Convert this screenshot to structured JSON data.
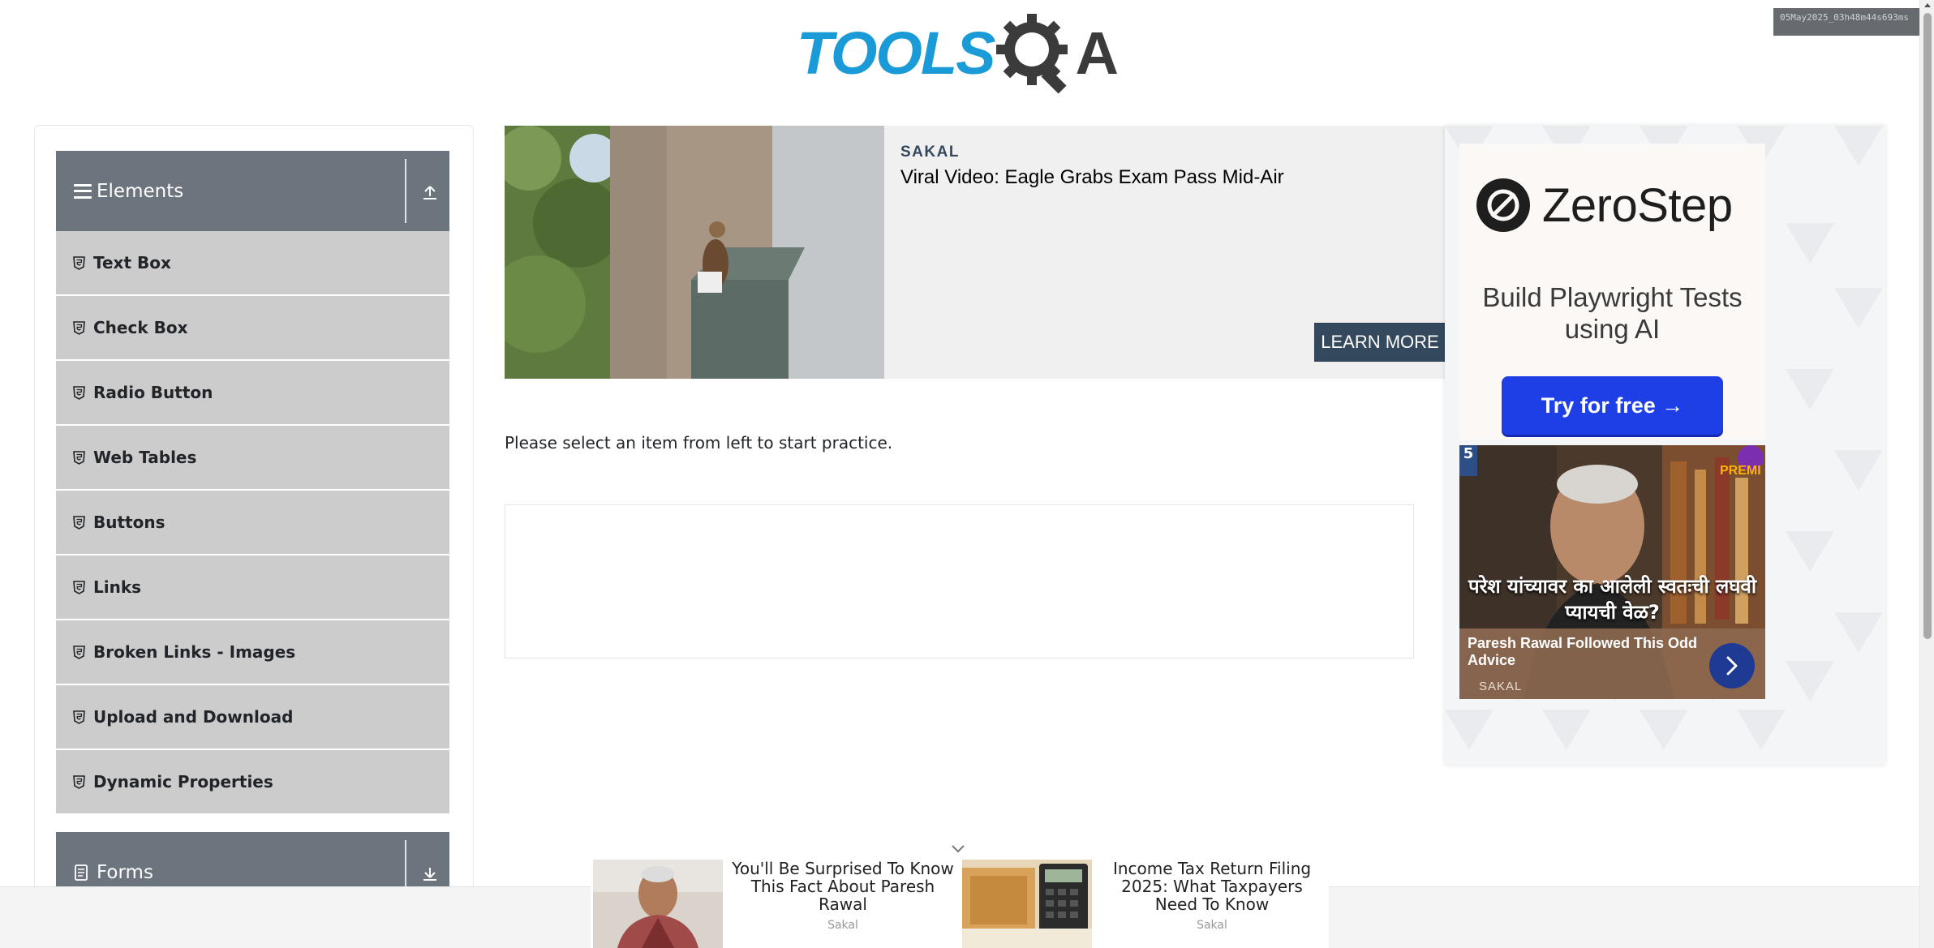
{
  "header": {
    "logo_part1": "TOOLS",
    "logo_part2": "A",
    "watermark": "05May2025_03h48m44s693ms"
  },
  "sidebar": {
    "groups": [
      {
        "title": "Elements",
        "expanded": true,
        "icon": "hamburger-icon",
        "items": [
          {
            "label": "Text Box"
          },
          {
            "label": "Check Box"
          },
          {
            "label": "Radio Button"
          },
          {
            "label": "Web Tables"
          },
          {
            "label": "Buttons"
          },
          {
            "label": "Links"
          },
          {
            "label": "Broken Links - Images"
          },
          {
            "label": "Upload and Download"
          },
          {
            "label": "Dynamic Properties"
          }
        ]
      },
      {
        "title": "Forms",
        "expanded": false,
        "icon": "document-icon"
      }
    ]
  },
  "main": {
    "ad": {
      "source": "SAKAL",
      "headline": "Viral Video: Eagle Grabs Exam Pass Mid-Air",
      "cta": "LEARN MORE"
    },
    "prompt": "Please select an item from left to start practice."
  },
  "right_ad": {
    "brand": "ZeroStep",
    "tagline": "Build Playwright Tests using AI",
    "cta": "Try for free →",
    "news": {
      "overlay_text": "परेश यांच्यावर का आलेली स्वतःची लघवी प्यायची वेळ?",
      "title": "Paresh Rawal Followed This Odd Advice",
      "source": "SAKAL",
      "badge": "PREMI",
      "corner": "5"
    }
  },
  "bottom_ad": {
    "items": [
      {
        "title": "You'll Be Surprised To Know This Fact About Paresh Rawal",
        "source": "Sakal"
      },
      {
        "title": "Income Tax Return Filing 2025: What Taxpayers Need To Know",
        "source": "Sakal"
      }
    ]
  },
  "colors": {
    "sidebar_header": "#6c757d",
    "menu_item": "#cccccc",
    "logo_blue": "#1a9bd7",
    "cta_dark": "#34495e",
    "zerostep_blue": "#1f3fe6"
  }
}
